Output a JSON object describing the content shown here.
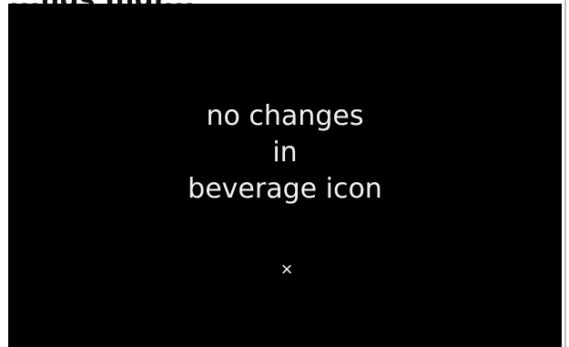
{
  "header": {
    "title_fragment": "...ngs Ingr..."
  },
  "dialog": {
    "message_lines": [
      "no changes",
      "in",
      "beverage icon"
    ],
    "close_button_glyph": "×",
    "close_icon": "close-icon"
  },
  "colors": {
    "screen_background": "#000000",
    "text": "#f2f2f2"
  }
}
